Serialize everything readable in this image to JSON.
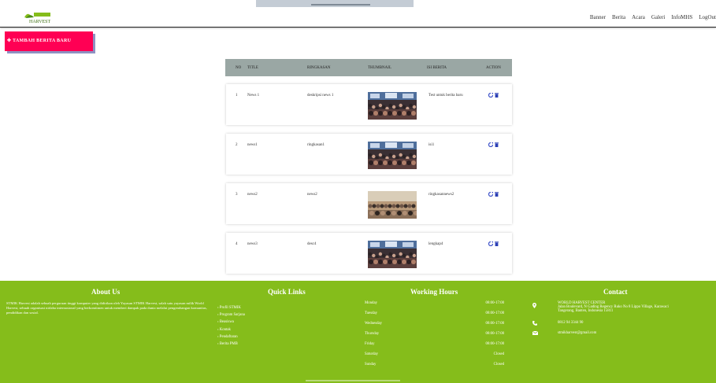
{
  "header": {
    "logo_text": "HARVEST",
    "nav": [
      "Banner",
      "Berita",
      "Acara",
      "Galeri",
      "InfoMHS",
      "LogOut"
    ]
  },
  "add_button": {
    "label": "✚ TAMBAH BERITA BARU"
  },
  "table": {
    "columns": [
      "NO",
      "TITLE",
      "RINGKASAN",
      "THUMBNAIL",
      "ISI BERITA",
      "ACTION"
    ],
    "rows": [
      {
        "no": "1",
        "title": "News 1",
        "summary": "deskripsi news 1",
        "content": "Test untuk berita baru",
        "thumb": "dark"
      },
      {
        "no": "2",
        "title": "news1",
        "summary": "ringkasan1",
        "content": "isi1",
        "thumb": "dark"
      },
      {
        "no": "3",
        "title": "news2",
        "summary": "news2",
        "content": "ringkasannews2",
        "thumb": "light"
      },
      {
        "no": "4",
        "title": "news3",
        "summary": "desc4",
        "content": "lengkap4",
        "thumb": "dark"
      }
    ]
  },
  "footer": {
    "about": {
      "title": "About Us",
      "text": "STMIK Harvest adalah sebuah perguruan tinggi komputer yang didirikan oleh Yayasan STMIK Harvest, salah satu yayasan milik World Harvest, sebuah organisasi nirlaba internasional yang berkomitmen untuk memberi dampak pada dunia melalui pengembangan komunitas, pendidikan dan sosial."
    },
    "quick_links": {
      "title": "Quick Links",
      "items": [
        "› Profil STMIK",
        "› Program Sarjana",
        "› Beasiswa",
        "› Kontak",
        "› Pendaftaran",
        "› Berita PMB"
      ]
    },
    "hours": {
      "title": "Working Hours",
      "rows": [
        {
          "day": "Monday",
          "time": "08:00-17:00"
        },
        {
          "day": "Tuesday",
          "time": "08:00-17:00"
        },
        {
          "day": "Wednesday",
          "time": "08:00-17:00"
        },
        {
          "day": "Thursday",
          "time": "08:00-17:00"
        },
        {
          "day": "Friday",
          "time": "08:00-17:00"
        },
        {
          "day": "Saturday",
          "time": "Closed"
        },
        {
          "day": "Sunday",
          "time": "Closed"
        }
      ]
    },
    "contact": {
      "title": "Contact",
      "org": "WORLD HARVEST CENTER",
      "address_1": "Jalan Boulevard, N Gading Regency Ruko No 8 Lippo Village, Karawaci",
      "address_2": "Tangerang, Banten, Indonesia 15811",
      "phone": "0812 94 3344 90",
      "email": "stmikharvest@gmail.com"
    }
  },
  "colors": {
    "footer_bg": "#85bd1b",
    "button_bg": "#ff0054",
    "header_row": "#9aa7a4"
  }
}
